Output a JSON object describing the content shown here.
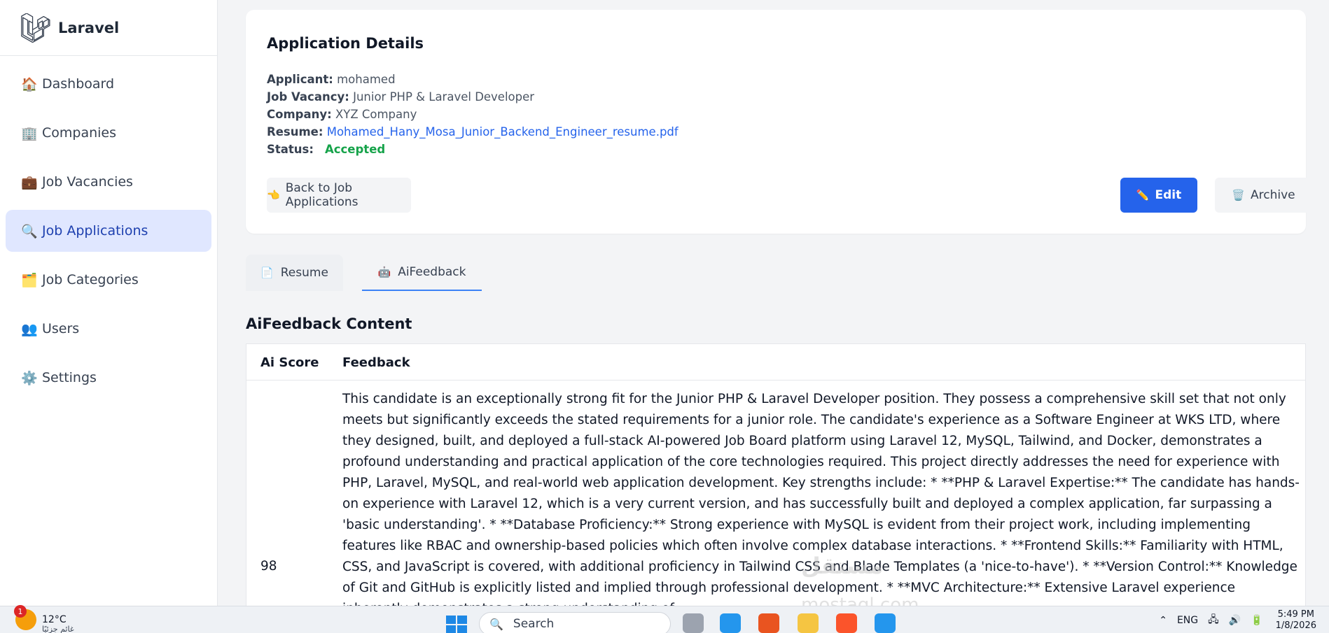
{
  "app": {
    "name": "Laravel"
  },
  "sidebar": {
    "items": [
      {
        "icon": "🏠",
        "label": "Dashboard"
      },
      {
        "icon": "🏢",
        "label": "Companies"
      },
      {
        "icon": "💼",
        "label": "Job Vacancies"
      },
      {
        "icon": "🔍",
        "label": "Job Applications"
      },
      {
        "icon": "🗂️",
        "label": "Job Categories"
      },
      {
        "icon": "👥",
        "label": "Users"
      },
      {
        "icon": "⚙️",
        "label": "Settings"
      }
    ]
  },
  "details": {
    "title": "Application Details",
    "applicant_label": "Applicant:",
    "applicant": "mohamed",
    "vacancy_label": "Job Vacancy:",
    "vacancy": "Junior PHP & Laravel Developer",
    "company_label": "Company:",
    "company": "XYZ Company",
    "resume_label": "Resume:",
    "resume": "Mohamed_Hany_Mosa_Junior_Backend_Engineer_resume.pdf",
    "status_label": "Status:",
    "status": "Accepted",
    "status_color": "#16a34a"
  },
  "actions": {
    "back_icon": "👈",
    "back": "Back to Job Applications",
    "edit_icon": "✏️",
    "edit": "Edit",
    "archive_icon": "🗑️",
    "archive": "Archive"
  },
  "tabs": {
    "resume_icon": "📄",
    "resume": "Resume",
    "ai_icon": "🤖",
    "ai": "AiFeedback"
  },
  "feedback": {
    "title": "AiFeedback Content",
    "col_score": "Ai Score",
    "col_feedback": "Feedback",
    "score": "98",
    "text": "This candidate is an exceptionally strong fit for the Junior PHP & Laravel Developer position. They possess a comprehensive skill set that not only meets but significantly exceeds the stated requirements for a junior role. The candidate's experience as a Software Engineer at WKS LTD, where they designed, built, and deployed a full-stack AI-powered Job Board platform using Laravel 12, MySQL, Tailwind, and Docker, demonstrates a profound understanding and practical application of the core technologies required. This project directly addresses the need for experience with PHP, Laravel, MySQL, and real-world web application development. Key strengths include: * **PHP & Laravel Expertise:** The candidate has hands-on experience with Laravel 12, which is a very current version, and has successfully built and deployed a complex application, far surpassing a 'basic understanding'. * **Database Proficiency:** Strong experience with MySQL is evident from their project work, including implementing features like RBAC and ownership-based policies which often involve complex database interactions. * **Frontend Skills:** Familiarity with HTML, CSS, and JavaScript is covered, with additional proficiency in Tailwind CSS and Blade Templates (a 'nice-to-have'). * **Version Control:** Knowledge of Git and GitHub is explicitly listed and implied through professional development. * **MVC Architecture:** Extensive Laravel experience inherently demonstrates a strong understanding of"
  },
  "watermark": {
    "arabic": "مستقل",
    "latin": "mostaql.com"
  },
  "taskbar": {
    "weather_badge": "1",
    "temperature": "12°C",
    "weather_sub": "غائم جزئيًا",
    "search": "Search",
    "language": "ENG",
    "time": "5:49 PM",
    "date": "1/8/2026"
  }
}
